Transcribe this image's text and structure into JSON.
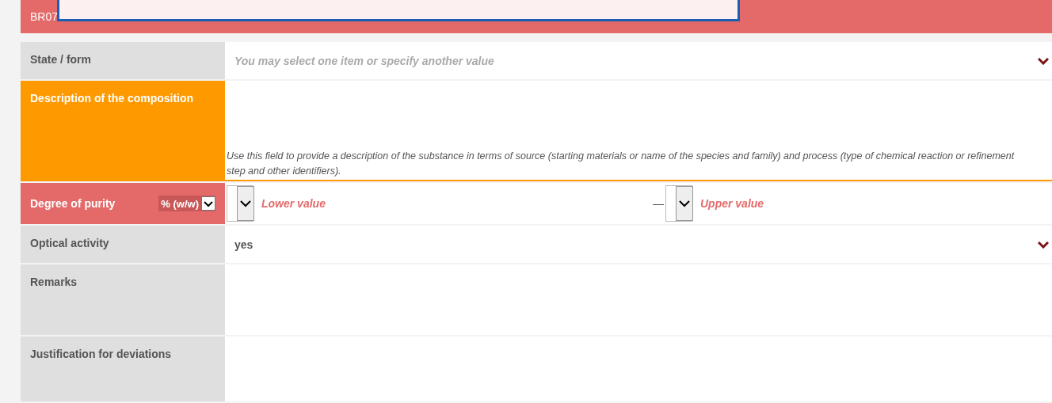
{
  "banner": {
    "text": "BR07"
  },
  "rows": [
    {
      "kind": "select",
      "label": "State / form",
      "error": false,
      "warning": false,
      "placeholder": "You may select one item or specify another value"
    },
    {
      "kind": "textarea",
      "label": "Description of the composition",
      "error": false,
      "warning": true,
      "hint": "Use this field to provide a description of the substance in terms of source (starting materials or name of the species and family) and process (type of chemical reaction or refinement step and other identifiers)."
    },
    {
      "kind": "range",
      "label": "Degree of purity",
      "error": true,
      "warning": false,
      "unit": "% (w/w)",
      "lower": {
        "placeholder": "Lower value"
      },
      "separator": "—",
      "upper": {
        "placeholder": "Upper value"
      }
    },
    {
      "kind": "select",
      "label": "Optical activity",
      "error": false,
      "warning": false,
      "value": "yes"
    },
    {
      "kind": "textarea",
      "label": "Remarks",
      "error": false,
      "warning": false
    },
    {
      "kind": "textarea",
      "label": "Justification for deviations",
      "error": false,
      "warning": false
    }
  ]
}
